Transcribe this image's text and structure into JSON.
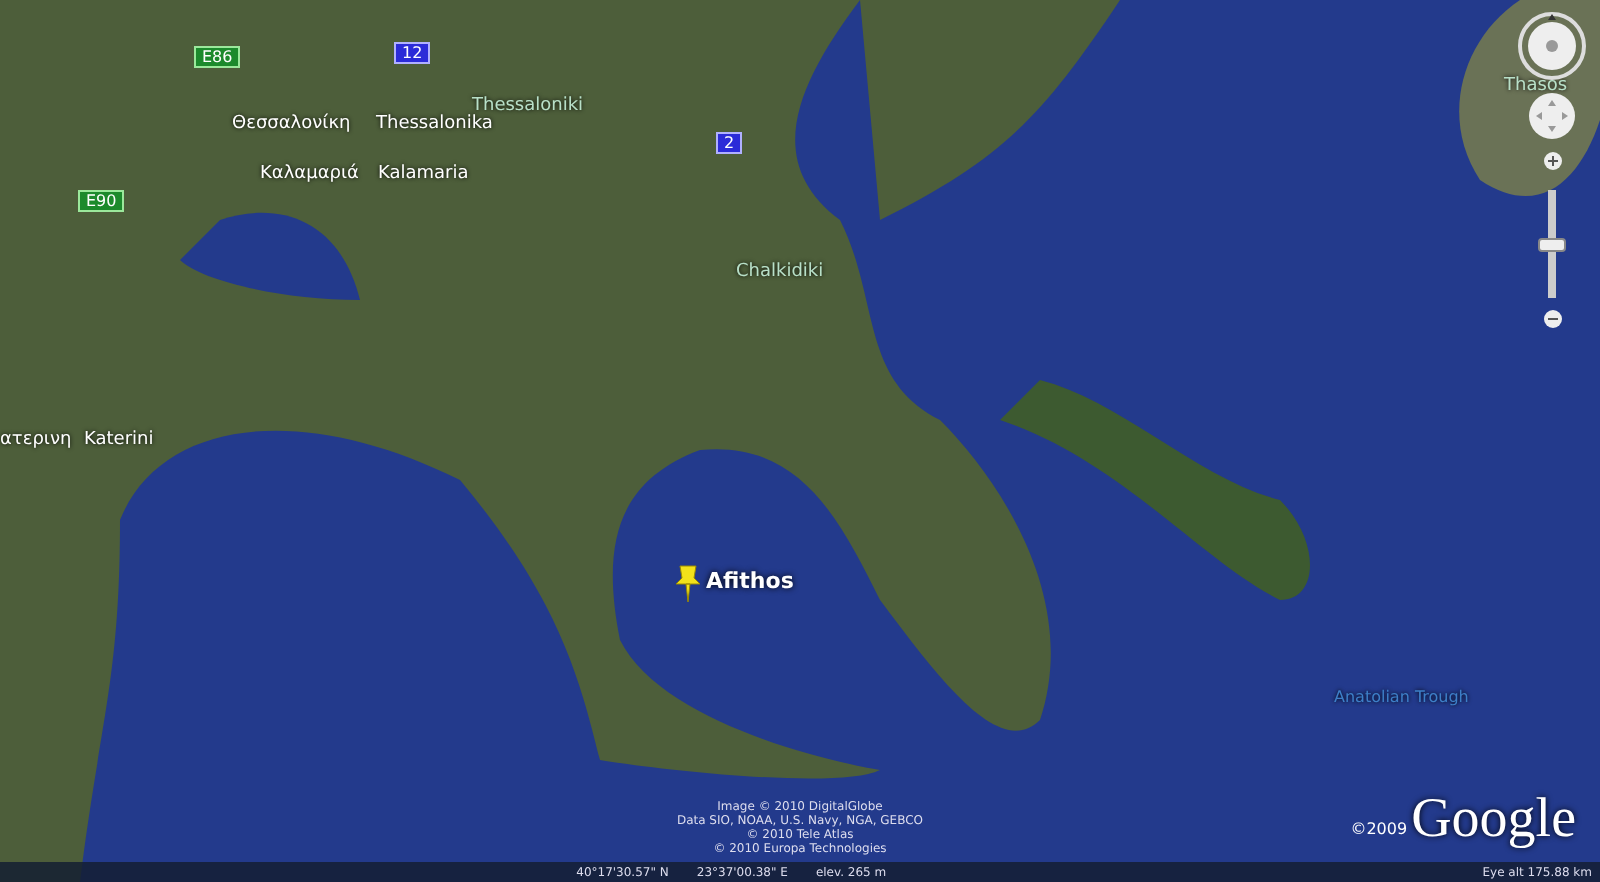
{
  "map": {
    "place_labels": [
      {
        "text": "Θεσσαλονίκη",
        "kind": "greek"
      },
      {
        "text": "Thessalonika",
        "kind": "city"
      },
      {
        "text": "Καλαμαριά",
        "kind": "greek"
      },
      {
        "text": "Kalamaria",
        "kind": "city"
      },
      {
        "text": "Thessaloniki",
        "kind": "region"
      },
      {
        "text": "Chalkidiki",
        "kind": "region"
      },
      {
        "text": "Thasos",
        "kind": "region"
      },
      {
        "text": "ατερινη",
        "kind": "greek"
      },
      {
        "text": "Katerini",
        "kind": "city"
      },
      {
        "text": "Anatolian Trough",
        "kind": "sea"
      }
    ],
    "road_shields": [
      {
        "text": "E86",
        "kind": "european"
      },
      {
        "text": "12",
        "kind": "national"
      },
      {
        "text": "E90",
        "kind": "european"
      },
      {
        "text": "2",
        "kind": "national"
      }
    ],
    "placemark": {
      "label": "Afithos"
    },
    "attribution": [
      "Image © 2010 DigitalGlobe",
      "Data SIO, NOAA, U.S. Navy, NGA, GEBCO",
      "© 2010 Tele Atlas",
      "© 2010 Europa Technologies"
    ],
    "copyright": "©2009",
    "logo": "Google",
    "zoom_slider": {
      "level": 0.5
    }
  },
  "status_bar": {
    "latitude": "40°17'30.57\" N",
    "longitude": "23°37'00.38\" E",
    "elevation": "elev. 265 m",
    "eye_altitude": "Eye alt  175.88 km"
  }
}
